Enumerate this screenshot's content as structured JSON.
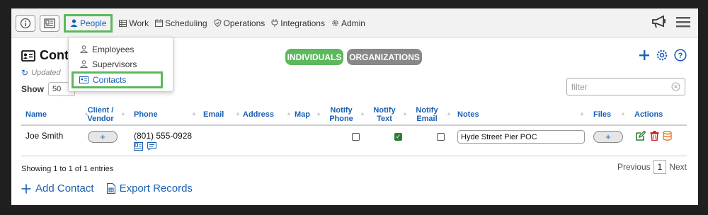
{
  "nav": {
    "items": [
      {
        "label": "People",
        "active": true
      },
      {
        "label": "Work"
      },
      {
        "label": "Scheduling"
      },
      {
        "label": "Operations"
      },
      {
        "label": "Integrations"
      },
      {
        "label": "Admin"
      }
    ]
  },
  "dropdown": {
    "items": [
      {
        "label": "Employees"
      },
      {
        "label": "Supervisors"
      },
      {
        "label": "Contacts",
        "active": true
      }
    ]
  },
  "page": {
    "title": "Conta",
    "updated": "Updated",
    "segments": {
      "individuals": "INDIVIDUALS",
      "organizations": "ORGANIZATIONS"
    },
    "show_label": "Show",
    "show_value": "50",
    "entries_label": "entries",
    "filter_placeholder": "filter"
  },
  "table": {
    "headers": {
      "name": "Name",
      "client_vendor": "Client / Vendor",
      "phone": "Phone",
      "email": "Email",
      "address": "Address",
      "map": "Map",
      "notify_phone": "Notify Phone",
      "notify_text": "Notify Text",
      "notify_email": "Notify Email",
      "notes": "Notes",
      "files": "Files",
      "actions": "Actions"
    },
    "rows": [
      {
        "name": "Joe Smith",
        "client_vendor": "+",
        "phone": "(801) 555-0928",
        "notify_phone": false,
        "notify_text": true,
        "notify_email": false,
        "notes": "Hyde Street Pier POC",
        "files": "+"
      }
    ]
  },
  "footer": {
    "info": "Showing 1 to 1 of 1 entries",
    "previous": "Previous",
    "page": "1",
    "next": "Next",
    "add_contact": "Add Contact",
    "export": "Export Records"
  },
  "colors": {
    "accent": "#1a5fb4",
    "green": "#5cb85c",
    "gray": "#888888"
  }
}
